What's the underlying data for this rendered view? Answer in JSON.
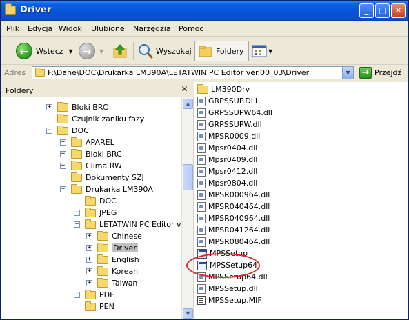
{
  "window": {
    "title": "Driver"
  },
  "menu": [
    "Plik",
    "Edycja",
    "Widok",
    "Ulubione",
    "Narzędzia",
    "Pomoc"
  ],
  "toolbar": {
    "back_label": "Wstecz",
    "search_label": "Wyszukaj",
    "folders_label": "Foldery"
  },
  "address": {
    "label": "Adres",
    "value": "F:\\Dane\\DOC\\Drukarka LM390A\\LETATWIN PC Editor ver.00_03\\Driver",
    "go_label": "Przejdź"
  },
  "folders_pane": {
    "title": "Foldery",
    "tree": [
      {
        "label": "Bloki BRC",
        "level": 0,
        "expander": "+"
      },
      {
        "label": "Czujnik zaniku fazy",
        "level": 0,
        "expander": ""
      },
      {
        "label": "DOC",
        "level": 0,
        "expander": "-"
      },
      {
        "label": "APAREL",
        "level": 1,
        "expander": "+"
      },
      {
        "label": "Bloki BRC",
        "level": 1,
        "expander": "+"
      },
      {
        "label": "Clima RW",
        "level": 1,
        "expander": "+"
      },
      {
        "label": "Dokumenty SZJ",
        "level": 1,
        "expander": ""
      },
      {
        "label": "Drukarka LM390A",
        "level": 1,
        "expander": "-"
      },
      {
        "label": "DOC",
        "level": 2,
        "expander": ""
      },
      {
        "label": "JPEG",
        "level": 2,
        "expander": "+"
      },
      {
        "label": "LETATWIN PC Editor ver.",
        "level": 2,
        "expander": "-"
      },
      {
        "label": "Chinese",
        "level": 3,
        "expander": "+"
      },
      {
        "label": "Driver",
        "level": 3,
        "expander": "+",
        "selected": true
      },
      {
        "label": "English",
        "level": 3,
        "expander": "+"
      },
      {
        "label": "Korean",
        "level": 3,
        "expander": "+"
      },
      {
        "label": "Taiwan",
        "level": 3,
        "expander": "+"
      },
      {
        "label": "PDF",
        "level": 2,
        "expander": "+"
      },
      {
        "label": "PEN",
        "level": 2,
        "expander": ""
      }
    ]
  },
  "files": [
    {
      "name": "LM390Drv",
      "type": "folder"
    },
    {
      "name": "GRPSSUP.DLL",
      "type": "dll"
    },
    {
      "name": "GRPSSUPW64.dll",
      "type": "dll"
    },
    {
      "name": "GRPSSUPW.dll",
      "type": "dll"
    },
    {
      "name": "MPSR0009.dll",
      "type": "dll"
    },
    {
      "name": "Mpsr0404.dll",
      "type": "dll"
    },
    {
      "name": "Mpsr0409.dll",
      "type": "dll"
    },
    {
      "name": "Mpsr0412.dll",
      "type": "dll"
    },
    {
      "name": "Mpsr0804.dll",
      "type": "dll"
    },
    {
      "name": "MPSR000964.dll",
      "type": "dll"
    },
    {
      "name": "MPSR040464.dll",
      "type": "dll"
    },
    {
      "name": "MPSR040964.dll",
      "type": "dll"
    },
    {
      "name": "MPSR041264.dll",
      "type": "dll"
    },
    {
      "name": "MPSR080464.dll",
      "type": "dll"
    },
    {
      "name": "MPSSetup",
      "type": "exe"
    },
    {
      "name": "MPSSetup64",
      "type": "exe"
    },
    {
      "name": "MPSSetup64.dll",
      "type": "dll"
    },
    {
      "name": "MPSSetup.dll",
      "type": "dll"
    },
    {
      "name": "MPSSetup.MIF",
      "type": "mif"
    }
  ]
}
